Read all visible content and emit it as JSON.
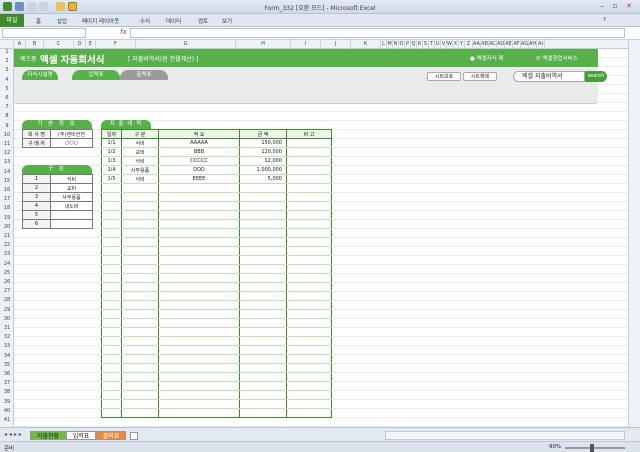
{
  "window": {
    "title": "Form_332 [호환 모드] - Microsoft Excel"
  },
  "ribbon": {
    "file_tab": "파일",
    "tabs": [
      "홈",
      "삽입",
      "페이지 레이아웃",
      "수식",
      "데이터",
      "검토",
      "보기"
    ]
  },
  "formula_bar": {
    "fx": "fx",
    "content": ""
  },
  "columns": [
    "A",
    "B",
    "C",
    "D",
    "E",
    "F",
    "G",
    "H",
    "I",
    "J",
    "K",
    "L",
    "M",
    "N",
    "O",
    "P",
    "Q",
    "R",
    "S",
    "T",
    "U",
    "V",
    "W",
    "X",
    "Y",
    "Z",
    "AA",
    "AB",
    "AC",
    "AD",
    "AE",
    "AF",
    "AG",
    "AH",
    "AI"
  ],
  "rows": [
    "1",
    "2",
    "3",
    "4",
    "5",
    "6",
    "7",
    "8",
    "9",
    "10",
    "11",
    "12",
    "13",
    "14",
    "15",
    "16",
    "17",
    "18",
    "19",
    "20",
    "21",
    "22",
    "23",
    "24",
    "25",
    "26",
    "27",
    "28",
    "29",
    "30",
    "31",
    "32",
    "33",
    "34",
    "35",
    "36",
    "37",
    "38",
    "39",
    "40",
    "41"
  ],
  "banner": {
    "brand": "예즈폼",
    "title": "엑셀 자동회서식",
    "subtitle": "[ 지출비역서(현 잔월계산) ]",
    "link1": "엑셀자식 매",
    "link2": "엑셀창업서비스"
  },
  "tabs": {
    "tab1": "자식시설명",
    "tab2": "입력표",
    "tab3": "출력표"
  },
  "tools": {
    "btn1": "시트보호",
    "btn2": "시트해제",
    "search_value": "엑셀 지출비역서",
    "search_label": "search"
  },
  "info_panel": {
    "header": "기 본 정 보",
    "rows": [
      {
        "label": "회 사 명",
        "value": "(주)엔비한전"
      },
      {
        "label": "구 매 자",
        "value": "○○○"
      }
    ]
  },
  "category_panel": {
    "header": "구 분",
    "rows": [
      [
        "1",
        "식비"
      ],
      [
        "2",
        "교비"
      ],
      [
        "3",
        "사무용품"
      ],
      [
        "4",
        "내노비"
      ],
      [
        "5",
        ""
      ],
      [
        "6",
        ""
      ]
    ]
  },
  "main_panel": {
    "header": "지 출 내 역",
    "columns": [
      "일자",
      "구 분",
      "적 요",
      "금 액",
      "비 고"
    ],
    "rows": [
      [
        "1/1",
        "식비",
        "AAAAA",
        "150,000",
        ""
      ],
      [
        "1/2",
        "교비",
        "BBB",
        "120,000",
        ""
      ],
      [
        "1/3",
        "식비",
        "CCCCC",
        "12,000",
        ""
      ],
      [
        "1/4",
        "사무용품",
        "DDD",
        "1,000,000",
        ""
      ],
      [
        "1/5",
        "식비",
        "EEEE",
        "5,000",
        ""
      ]
    ],
    "blank_rows": 26
  },
  "sheet_tabs": [
    "지출현황",
    "입력표",
    "출력표"
  ],
  "status": {
    "ready": "준비",
    "zoom": "90%"
  }
}
